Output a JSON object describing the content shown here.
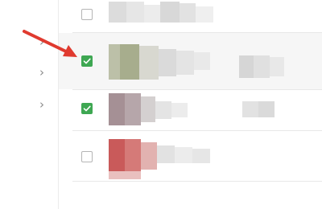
{
  "window": {
    "background": "#ffffff"
  },
  "sidebar": {
    "background": "#ffffff",
    "items": [
      {
        "icon": "chevron-right-icon"
      },
      {
        "icon": "chevron-right-icon"
      },
      {
        "icon": "chevron-right-icon"
      }
    ]
  },
  "rows": [
    {
      "checked": false,
      "highlighted": false,
      "content": "pixelated"
    },
    {
      "checked": true,
      "highlighted": true,
      "content": "pixelated"
    },
    {
      "checked": true,
      "highlighted": false,
      "content": "pixelated"
    },
    {
      "checked": false,
      "highlighted": false,
      "content": "pixelated"
    }
  ],
  "colors": {
    "checkbox_checked": "#3ea752",
    "checkbox_border": "#b5b5b5",
    "row_highlight": "#f6f6f6",
    "divider": "#e8e8e8",
    "annotation_arrow": "#e03a2f"
  },
  "annotation": {
    "type": "arrow",
    "target": "row-2-checkbox",
    "color": "#e03a2f"
  }
}
